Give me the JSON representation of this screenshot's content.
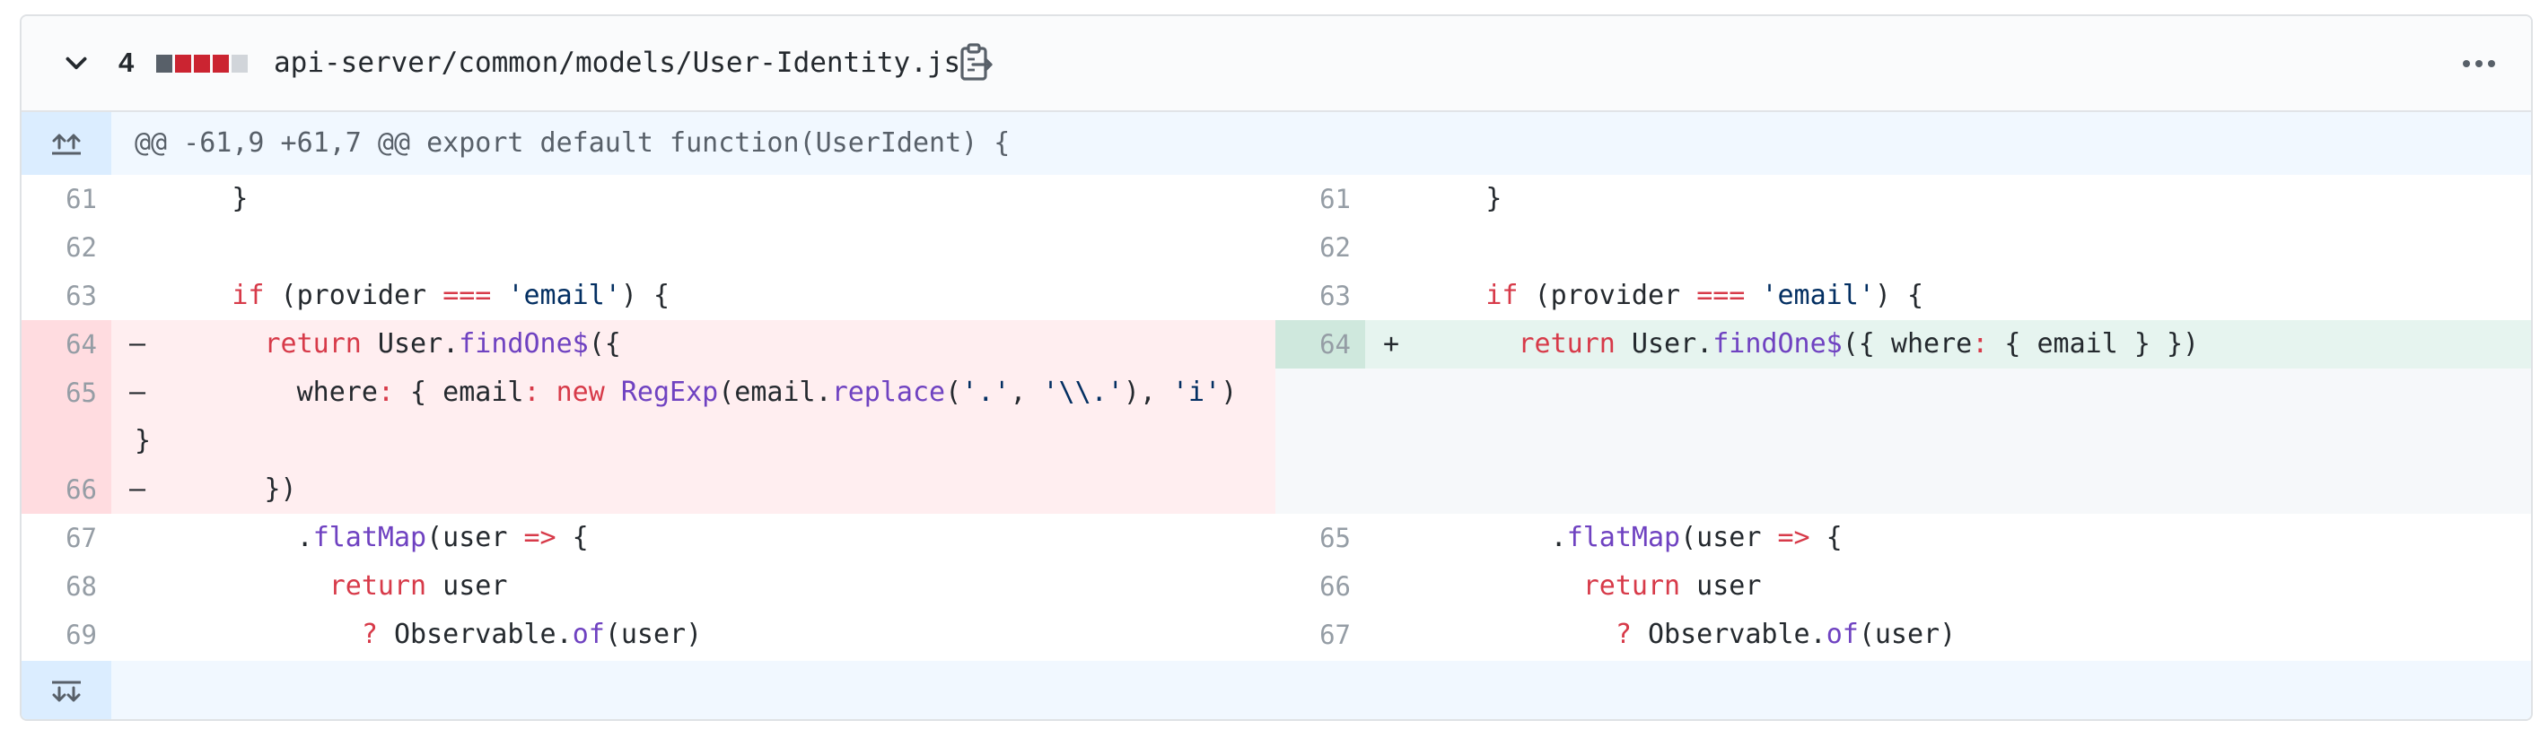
{
  "file": {
    "change_count": "4",
    "path": "api-server/common/models/User-Identity.js",
    "diffstat_colors": [
      "#586069",
      "#cb2431",
      "#cb2431",
      "#cb2431",
      "#d1d5da"
    ]
  },
  "icons": {
    "collapse": "chevron-down-icon",
    "copy": "clipboard-copy-icon",
    "more": "kebab-horizontal-icon",
    "expand_up": "unfold-up-icon",
    "expand_down": "unfold-down-icon"
  },
  "hunk": {
    "header": "@@ -61,9 +61,7 @@ export default function(UserIdent) {"
  },
  "left": {
    "lines": [
      {
        "num": "61",
        "type": "ctx",
        "sign": "",
        "code": "      }"
      },
      {
        "num": "62",
        "type": "ctx",
        "sign": "",
        "code": ""
      },
      {
        "num": "63",
        "type": "ctx",
        "sign": "",
        "code": "      if (provider === 'email') {"
      },
      {
        "num": "64",
        "type": "del",
        "sign": "–",
        "code": "        return User.findOne$({"
      },
      {
        "num": "65",
        "type": "del",
        "sign": "–",
        "code": "          where: { email: new RegExp(email.replace('.', '\\\\.'), 'i')\n}"
      },
      {
        "num": "66",
        "type": "del",
        "sign": "–",
        "code": "        })"
      },
      {
        "num": "67",
        "type": "ctx",
        "sign": "",
        "code": "          .flatMap(user => {"
      },
      {
        "num": "68",
        "type": "ctx",
        "sign": "",
        "code": "            return user"
      },
      {
        "num": "69",
        "type": "ctx",
        "sign": "",
        "code": "              ? Observable.of(user)"
      }
    ]
  },
  "right": {
    "lines": [
      {
        "num": "61",
        "type": "ctx",
        "sign": "",
        "code": "      }"
      },
      {
        "num": "62",
        "type": "ctx",
        "sign": "",
        "code": ""
      },
      {
        "num": "63",
        "type": "ctx",
        "sign": "",
        "code": "      if (provider === 'email') {"
      },
      {
        "num": "64",
        "type": "add",
        "sign": "+",
        "code": "        return User.findOne$({ where: { email } })"
      },
      {
        "num": "",
        "type": "empty",
        "sign": "",
        "code": ""
      },
      {
        "num": "",
        "type": "empty",
        "sign": "",
        "code": ""
      },
      {
        "num": "65",
        "type": "ctx",
        "sign": "",
        "code": "          .flatMap(user => {"
      },
      {
        "num": "66",
        "type": "ctx",
        "sign": "",
        "code": "            return user"
      },
      {
        "num": "67",
        "type": "ctx",
        "sign": "",
        "code": "              ? Observable.of(user)"
      }
    ]
  }
}
